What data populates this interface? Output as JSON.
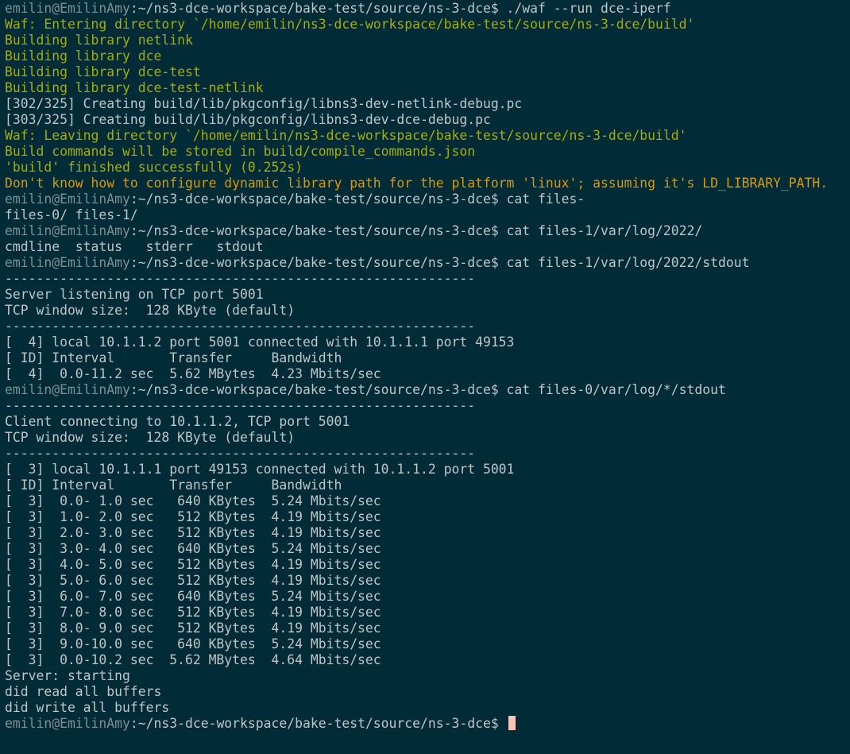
{
  "theme": {
    "background": "#012b36",
    "foreground": "#bfc6c9",
    "prompt_user": "#7f8f94",
    "waf_yellow": "#a8ad00",
    "warning_orange": "#d79a08",
    "cursor": "#f6c6b8"
  },
  "prompt": {
    "user_host": "emilin@EmilinAmy",
    "path": ":~/ns3-dce-workspace/bake-test/source/ns-3-dce$"
  },
  "lines": [
    {
      "type": "prompt",
      "command": " ./waf --run dce-iperf"
    },
    {
      "type": "waf",
      "text": "Waf: Entering directory `/home/emilin/ns3-dce-workspace/bake-test/source/ns-3-dce/build'"
    },
    {
      "type": "waf",
      "text": "Building library netlink"
    },
    {
      "type": "waf",
      "text": "Building library dce"
    },
    {
      "type": "waf",
      "text": "Building library dce-test"
    },
    {
      "type": "waf",
      "text": "Building library dce-test-netlink"
    },
    {
      "type": "out",
      "text": "[302/325] Creating build/lib/pkgconfig/libns3-dev-netlink-debug.pc"
    },
    {
      "type": "out",
      "text": "[303/325] Creating build/lib/pkgconfig/libns3-dev-dce-debug.pc"
    },
    {
      "type": "waf",
      "text": "Waf: Leaving directory `/home/emilin/ns3-dce-workspace/bake-test/source/ns-3-dce/build'"
    },
    {
      "type": "waf",
      "text": "Build commands will be stored in build/compile_commands.json"
    },
    {
      "type": "waf",
      "text": "'build' finished successfully (0.252s)"
    },
    {
      "type": "warn",
      "text": "Don't know how to configure dynamic library path for the platform 'linux'; assuming it's LD_LIBRARY_PATH."
    },
    {
      "type": "prompt",
      "command": " cat files-"
    },
    {
      "type": "out",
      "text": "files-0/ files-1/"
    },
    {
      "type": "prompt",
      "command": " cat files-1/var/log/2022/"
    },
    {
      "type": "out",
      "text": "cmdline  status   stderr   stdout"
    },
    {
      "type": "prompt",
      "command": " cat files-1/var/log/2022/stdout"
    },
    {
      "type": "out",
      "text": "------------------------------------------------------------"
    },
    {
      "type": "out",
      "text": "Server listening on TCP port 5001"
    },
    {
      "type": "out",
      "text": "TCP window size:  128 KByte (default)"
    },
    {
      "type": "out",
      "text": "------------------------------------------------------------"
    },
    {
      "type": "out",
      "text": "[  4] local 10.1.1.2 port 5001 connected with 10.1.1.1 port 49153"
    },
    {
      "type": "out",
      "text": "[ ID] Interval       Transfer     Bandwidth"
    },
    {
      "type": "out",
      "text": "[  4]  0.0-11.2 sec  5.62 MBytes  4.23 Mbits/sec"
    },
    {
      "type": "prompt",
      "command": " cat files-0/var/log/*/stdout"
    },
    {
      "type": "out",
      "text": "------------------------------------------------------------"
    },
    {
      "type": "out",
      "text": "Client connecting to 10.1.1.2, TCP port 5001"
    },
    {
      "type": "out",
      "text": "TCP window size:  128 KByte (default)"
    },
    {
      "type": "out",
      "text": "------------------------------------------------------------"
    },
    {
      "type": "out",
      "text": "[  3] local 10.1.1.1 port 49153 connected with 10.1.1.2 port 5001"
    },
    {
      "type": "out",
      "text": "[ ID] Interval       Transfer     Bandwidth"
    },
    {
      "type": "out",
      "text": "[  3]  0.0- 1.0 sec   640 KBytes  5.24 Mbits/sec"
    },
    {
      "type": "out",
      "text": "[  3]  1.0- 2.0 sec   512 KBytes  4.19 Mbits/sec"
    },
    {
      "type": "out",
      "text": "[  3]  2.0- 3.0 sec   512 KBytes  4.19 Mbits/sec"
    },
    {
      "type": "out",
      "text": "[  3]  3.0- 4.0 sec   640 KBytes  5.24 Mbits/sec"
    },
    {
      "type": "out",
      "text": "[  3]  4.0- 5.0 sec   512 KBytes  4.19 Mbits/sec"
    },
    {
      "type": "out",
      "text": "[  3]  5.0- 6.0 sec   512 KBytes  4.19 Mbits/sec"
    },
    {
      "type": "out",
      "text": "[  3]  6.0- 7.0 sec   640 KBytes  5.24 Mbits/sec"
    },
    {
      "type": "out",
      "text": "[  3]  7.0- 8.0 sec   512 KBytes  4.19 Mbits/sec"
    },
    {
      "type": "out",
      "text": "[  3]  8.0- 9.0 sec   512 KBytes  4.19 Mbits/sec"
    },
    {
      "type": "out",
      "text": "[  3]  9.0-10.0 sec   640 KBytes  5.24 Mbits/sec"
    },
    {
      "type": "out",
      "text": "[  3]  0.0-10.2 sec  5.62 MBytes  4.64 Mbits/sec"
    },
    {
      "type": "out",
      "text": "Server: starting"
    },
    {
      "type": "out",
      "text": "did read all buffers"
    },
    {
      "type": "out",
      "text": "did write all buffers"
    },
    {
      "type": "prompt",
      "command": " ",
      "cursor": true
    }
  ]
}
